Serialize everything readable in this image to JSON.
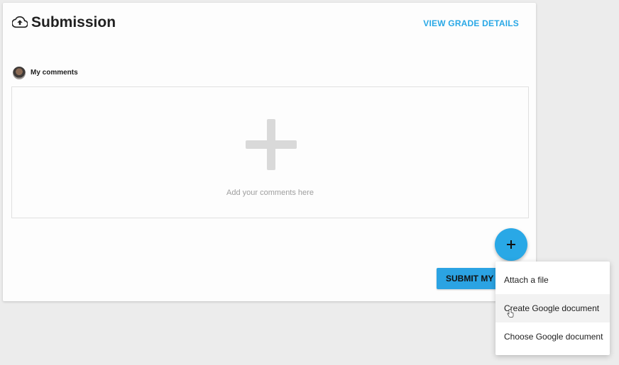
{
  "submission": {
    "title": "Submission",
    "header_icon": "cloud-upload-icon",
    "view_grade_details": "VIEW GRADE DETAILS"
  },
  "comments": {
    "label": "My comments",
    "placeholder": "Add your comments here",
    "avatar": "user-avatar",
    "add_icon": "plus-icon"
  },
  "actions": {
    "submit_label": "SUBMIT MY",
    "fab_icon": "plus-icon"
  },
  "menu": {
    "items": [
      {
        "label": "Attach a file"
      },
      {
        "label": "Create Google document"
      },
      {
        "label": "Choose Google document"
      }
    ],
    "hovered_item": "Create Google document"
  },
  "colors": {
    "accent": "#29a8e6",
    "background": "#ececec",
    "card": "#fdfdfd"
  }
}
